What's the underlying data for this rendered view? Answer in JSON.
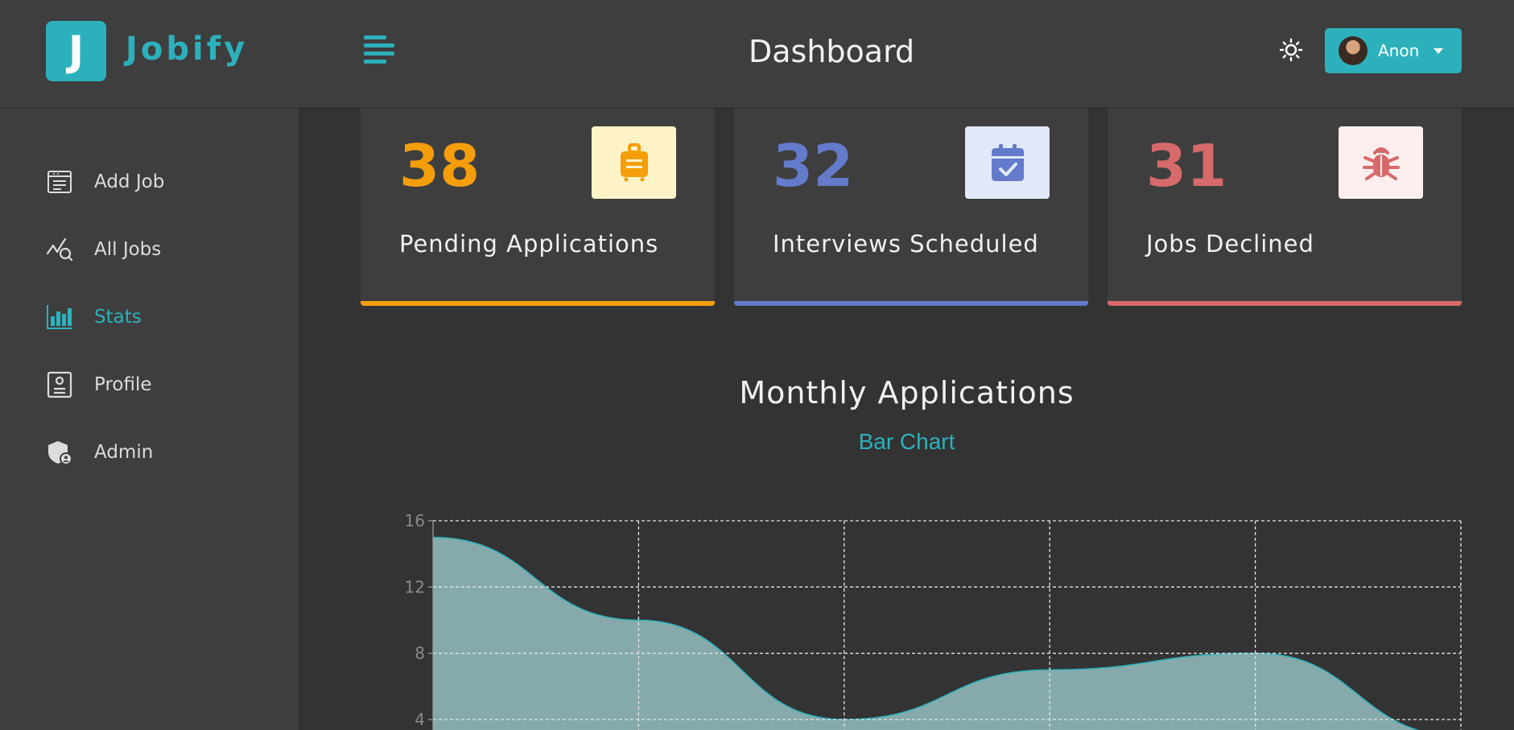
{
  "brand": {
    "logo_letter": "J",
    "name": "Jobify",
    "accent": "#2cb1bc"
  },
  "header": {
    "title": "Dashboard",
    "user_name": "Anon"
  },
  "sidebar": {
    "items": [
      {
        "label": "Add Job",
        "icon": "add-job-icon"
      },
      {
        "label": "All Jobs",
        "icon": "all-jobs-icon"
      },
      {
        "label": "Stats",
        "icon": "stats-icon",
        "active": true
      },
      {
        "label": "Profile",
        "icon": "profile-icon"
      },
      {
        "label": "Admin",
        "icon": "admin-icon"
      }
    ]
  },
  "stats": [
    {
      "count": "38",
      "title": "Pending Applications",
      "color": "#f59e0b",
      "bg": "#fef3c7",
      "icon": "suitcase-icon"
    },
    {
      "count": "32",
      "title": "Interviews Scheduled",
      "color": "#647acb",
      "bg": "#e0e8f9",
      "icon": "calendar-check-icon"
    },
    {
      "count": "31",
      "title": "Jobs Declined",
      "color": "#d66a6a",
      "bg": "#ffeeee",
      "icon": "bug-icon"
    }
  ],
  "chart": {
    "title": "Monthly Applications",
    "subtitle": "Bar Chart"
  },
  "chart_data": {
    "type": "area",
    "x": [
      0,
      1,
      2,
      3,
      4,
      5
    ],
    "values": [
      15,
      10,
      4,
      7,
      8,
      3
    ],
    "yticks": [
      "16",
      "12",
      "8",
      "4"
    ],
    "ylim": [
      0,
      16
    ],
    "grid": true,
    "fill_color": "#86aaab",
    "line_color": "#2cb1bc"
  }
}
